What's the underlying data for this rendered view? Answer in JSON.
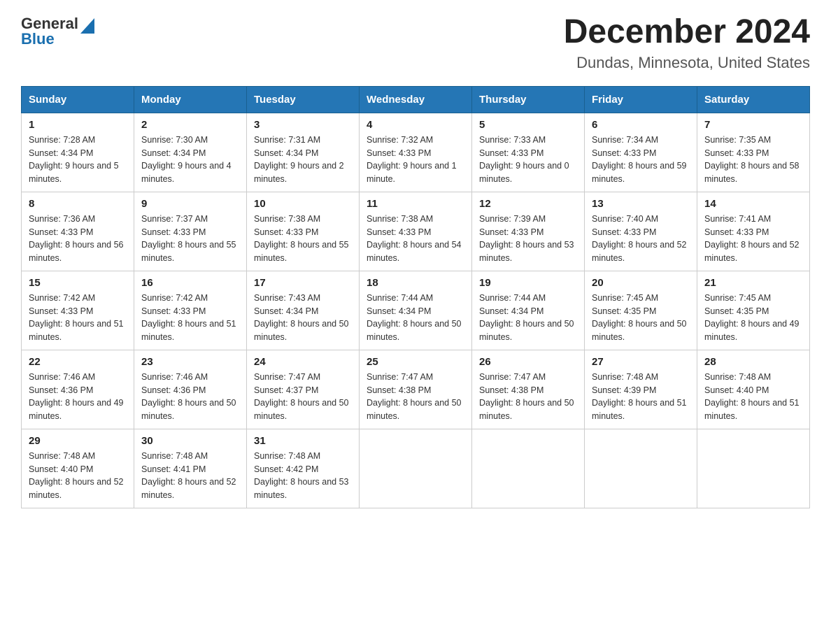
{
  "header": {
    "logo_line1": "General",
    "logo_line2": "Blue",
    "title": "December 2024",
    "subtitle": "Dundas, Minnesota, United States"
  },
  "weekdays": [
    "Sunday",
    "Monday",
    "Tuesday",
    "Wednesday",
    "Thursday",
    "Friday",
    "Saturday"
  ],
  "weeks": [
    [
      {
        "day": "1",
        "sunrise": "Sunrise: 7:28 AM",
        "sunset": "Sunset: 4:34 PM",
        "daylight": "Daylight: 9 hours and 5 minutes."
      },
      {
        "day": "2",
        "sunrise": "Sunrise: 7:30 AM",
        "sunset": "Sunset: 4:34 PM",
        "daylight": "Daylight: 9 hours and 4 minutes."
      },
      {
        "day": "3",
        "sunrise": "Sunrise: 7:31 AM",
        "sunset": "Sunset: 4:34 PM",
        "daylight": "Daylight: 9 hours and 2 minutes."
      },
      {
        "day": "4",
        "sunrise": "Sunrise: 7:32 AM",
        "sunset": "Sunset: 4:33 PM",
        "daylight": "Daylight: 9 hours and 1 minute."
      },
      {
        "day": "5",
        "sunrise": "Sunrise: 7:33 AM",
        "sunset": "Sunset: 4:33 PM",
        "daylight": "Daylight: 9 hours and 0 minutes."
      },
      {
        "day": "6",
        "sunrise": "Sunrise: 7:34 AM",
        "sunset": "Sunset: 4:33 PM",
        "daylight": "Daylight: 8 hours and 59 minutes."
      },
      {
        "day": "7",
        "sunrise": "Sunrise: 7:35 AM",
        "sunset": "Sunset: 4:33 PM",
        "daylight": "Daylight: 8 hours and 58 minutes."
      }
    ],
    [
      {
        "day": "8",
        "sunrise": "Sunrise: 7:36 AM",
        "sunset": "Sunset: 4:33 PM",
        "daylight": "Daylight: 8 hours and 56 minutes."
      },
      {
        "day": "9",
        "sunrise": "Sunrise: 7:37 AM",
        "sunset": "Sunset: 4:33 PM",
        "daylight": "Daylight: 8 hours and 55 minutes."
      },
      {
        "day": "10",
        "sunrise": "Sunrise: 7:38 AM",
        "sunset": "Sunset: 4:33 PM",
        "daylight": "Daylight: 8 hours and 55 minutes."
      },
      {
        "day": "11",
        "sunrise": "Sunrise: 7:38 AM",
        "sunset": "Sunset: 4:33 PM",
        "daylight": "Daylight: 8 hours and 54 minutes."
      },
      {
        "day": "12",
        "sunrise": "Sunrise: 7:39 AM",
        "sunset": "Sunset: 4:33 PM",
        "daylight": "Daylight: 8 hours and 53 minutes."
      },
      {
        "day": "13",
        "sunrise": "Sunrise: 7:40 AM",
        "sunset": "Sunset: 4:33 PM",
        "daylight": "Daylight: 8 hours and 52 minutes."
      },
      {
        "day": "14",
        "sunrise": "Sunrise: 7:41 AM",
        "sunset": "Sunset: 4:33 PM",
        "daylight": "Daylight: 8 hours and 52 minutes."
      }
    ],
    [
      {
        "day": "15",
        "sunrise": "Sunrise: 7:42 AM",
        "sunset": "Sunset: 4:33 PM",
        "daylight": "Daylight: 8 hours and 51 minutes."
      },
      {
        "day": "16",
        "sunrise": "Sunrise: 7:42 AM",
        "sunset": "Sunset: 4:33 PM",
        "daylight": "Daylight: 8 hours and 51 minutes."
      },
      {
        "day": "17",
        "sunrise": "Sunrise: 7:43 AM",
        "sunset": "Sunset: 4:34 PM",
        "daylight": "Daylight: 8 hours and 50 minutes."
      },
      {
        "day": "18",
        "sunrise": "Sunrise: 7:44 AM",
        "sunset": "Sunset: 4:34 PM",
        "daylight": "Daylight: 8 hours and 50 minutes."
      },
      {
        "day": "19",
        "sunrise": "Sunrise: 7:44 AM",
        "sunset": "Sunset: 4:34 PM",
        "daylight": "Daylight: 8 hours and 50 minutes."
      },
      {
        "day": "20",
        "sunrise": "Sunrise: 7:45 AM",
        "sunset": "Sunset: 4:35 PM",
        "daylight": "Daylight: 8 hours and 50 minutes."
      },
      {
        "day": "21",
        "sunrise": "Sunrise: 7:45 AM",
        "sunset": "Sunset: 4:35 PM",
        "daylight": "Daylight: 8 hours and 49 minutes."
      }
    ],
    [
      {
        "day": "22",
        "sunrise": "Sunrise: 7:46 AM",
        "sunset": "Sunset: 4:36 PM",
        "daylight": "Daylight: 8 hours and 49 minutes."
      },
      {
        "day": "23",
        "sunrise": "Sunrise: 7:46 AM",
        "sunset": "Sunset: 4:36 PM",
        "daylight": "Daylight: 8 hours and 50 minutes."
      },
      {
        "day": "24",
        "sunrise": "Sunrise: 7:47 AM",
        "sunset": "Sunset: 4:37 PM",
        "daylight": "Daylight: 8 hours and 50 minutes."
      },
      {
        "day": "25",
        "sunrise": "Sunrise: 7:47 AM",
        "sunset": "Sunset: 4:38 PM",
        "daylight": "Daylight: 8 hours and 50 minutes."
      },
      {
        "day": "26",
        "sunrise": "Sunrise: 7:47 AM",
        "sunset": "Sunset: 4:38 PM",
        "daylight": "Daylight: 8 hours and 50 minutes."
      },
      {
        "day": "27",
        "sunrise": "Sunrise: 7:48 AM",
        "sunset": "Sunset: 4:39 PM",
        "daylight": "Daylight: 8 hours and 51 minutes."
      },
      {
        "day": "28",
        "sunrise": "Sunrise: 7:48 AM",
        "sunset": "Sunset: 4:40 PM",
        "daylight": "Daylight: 8 hours and 51 minutes."
      }
    ],
    [
      {
        "day": "29",
        "sunrise": "Sunrise: 7:48 AM",
        "sunset": "Sunset: 4:40 PM",
        "daylight": "Daylight: 8 hours and 52 minutes."
      },
      {
        "day": "30",
        "sunrise": "Sunrise: 7:48 AM",
        "sunset": "Sunset: 4:41 PM",
        "daylight": "Daylight: 8 hours and 52 minutes."
      },
      {
        "day": "31",
        "sunrise": "Sunrise: 7:48 AM",
        "sunset": "Sunset: 4:42 PM",
        "daylight": "Daylight: 8 hours and 53 minutes."
      },
      null,
      null,
      null,
      null
    ]
  ]
}
